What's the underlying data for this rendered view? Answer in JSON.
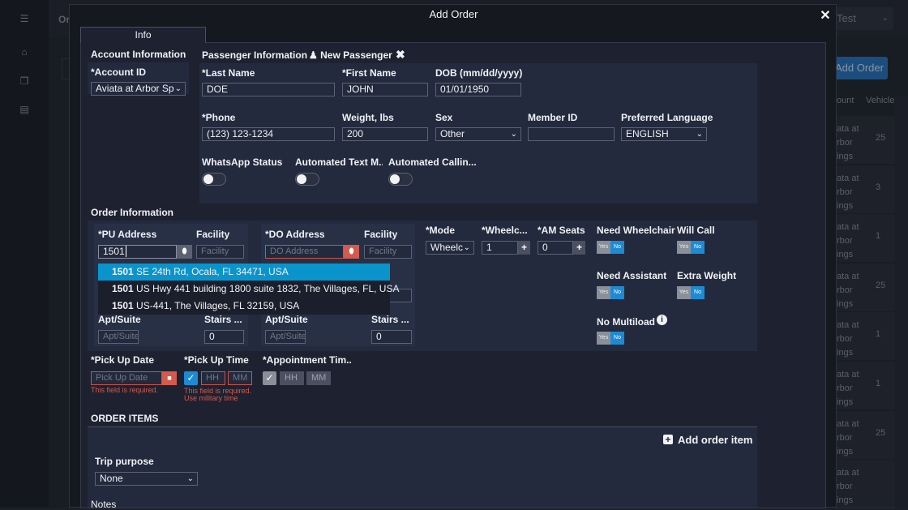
{
  "background": {
    "page_title": "Or",
    "user_label": "Test",
    "add_order_label": "Add Order",
    "table_headers": [
      "ount",
      "Vehicle"
    ],
    "rows": [
      {
        "name": "ata at rbor ings",
        "count": "25"
      },
      {
        "name": "ata at rbor ings",
        "count": "3"
      },
      {
        "name": "ata at rbor ings",
        "count": "1"
      },
      {
        "name": "ata at rbor ings",
        "count": "25"
      },
      {
        "name": "ata at rbor ings",
        "count": "1"
      },
      {
        "name": "ata at rbor ings",
        "count": "1"
      },
      {
        "name": "ata at rbor ings",
        "count": "25"
      },
      {
        "name": "ata at rbor ings",
        "count": ""
      }
    ]
  },
  "modal": {
    "title": "Add Order",
    "close_glyph": "✕",
    "tab": "Info"
  },
  "account": {
    "section": "Account Information",
    "id_label": "*Account ID",
    "id_value": "Aviata at Arbor Sp"
  },
  "passenger": {
    "section": "Passenger Information",
    "new_passenger": "New Passenger",
    "last_name_label": "*Last Name",
    "last_name": "DOE",
    "first_name_label": "*First Name",
    "first_name": "JOHN",
    "dob_label": "DOB (mm/dd/yyyy)",
    "dob": "01/01/1950",
    "phone_label": "*Phone",
    "phone": "(123) 123-1234",
    "weight_label": "Weight, lbs",
    "weight": "200",
    "sex_label": "Sex",
    "sex": "Other",
    "member_id_label": "Member ID",
    "member_id": "",
    "language_label": "Preferred Language",
    "language": "ENGLISH",
    "whatsapp_label": "WhatsApp Status",
    "text_label": "Automated Text M...",
    "calling_label": "Automated Callin..."
  },
  "order": {
    "section": "Order Information",
    "pu_label": "*PU Address",
    "pu_value": "1501",
    "pu_facility_label": "Facility",
    "pu_facility_ph": "Facility",
    "pu_apt_label": "Apt/Suite",
    "pu_apt_ph": "Apt/Suite",
    "pu_stairs_label": "Stairs ...",
    "pu_stairs": "0",
    "do_label": "*DO Address",
    "do_ph": "DO Address",
    "do_facility_label": "Facility",
    "do_facility_ph": "Facility",
    "do_apt_label": "Apt/Suite",
    "do_apt_ph": "Apt/Suite",
    "do_stairs_label": "Stairs ...",
    "do_stairs": "0",
    "mode_label": "*Mode",
    "mode": "Wheelc",
    "wheelchair_label": "*Wheelc...",
    "wheelchair": "1",
    "am_seats_label": "*AM Seats",
    "am_seats": "0",
    "need_wheelchair_label": "Need Wheelchair",
    "will_call_label": "Will Call",
    "need_assistant_label": "Need Assistant",
    "extra_weight_label": "Extra Weight",
    "no_multiload_label": "No Multiload",
    "yes": "Yes",
    "no": "No",
    "suggestions": [
      {
        "bold": "1501",
        "rest": " SE 24th Rd, Ocala, FL 34471, USA"
      },
      {
        "bold": "1501",
        "rest": " US Hwy 441 building 1800 suite 1832, The Villages, FL, USA"
      },
      {
        "bold": "1501",
        "rest": " US-441, The Villages, FL 32159, USA"
      }
    ],
    "pickup_date_label": "*Pick Up Date",
    "pickup_date_ph": "Pick Up Date",
    "pickup_date_err": "This field is required.",
    "pickup_time_label": "*Pick Up Time",
    "hh": "HH",
    "mm": "MM",
    "pickup_time_err1": "This field is required.",
    "pickup_time_err2": "Use military time",
    "appt_label": "*Appointment Tim..."
  },
  "items": {
    "section": "ORDER ITEMS",
    "add_item": "Add order item",
    "trip_purpose_label": "Trip purpose",
    "trip_purpose": "None",
    "notes_label": "Notes"
  },
  "colors": {
    "accent": "#0a94cc",
    "error": "#d35a4f",
    "panel": "#232a3d"
  }
}
